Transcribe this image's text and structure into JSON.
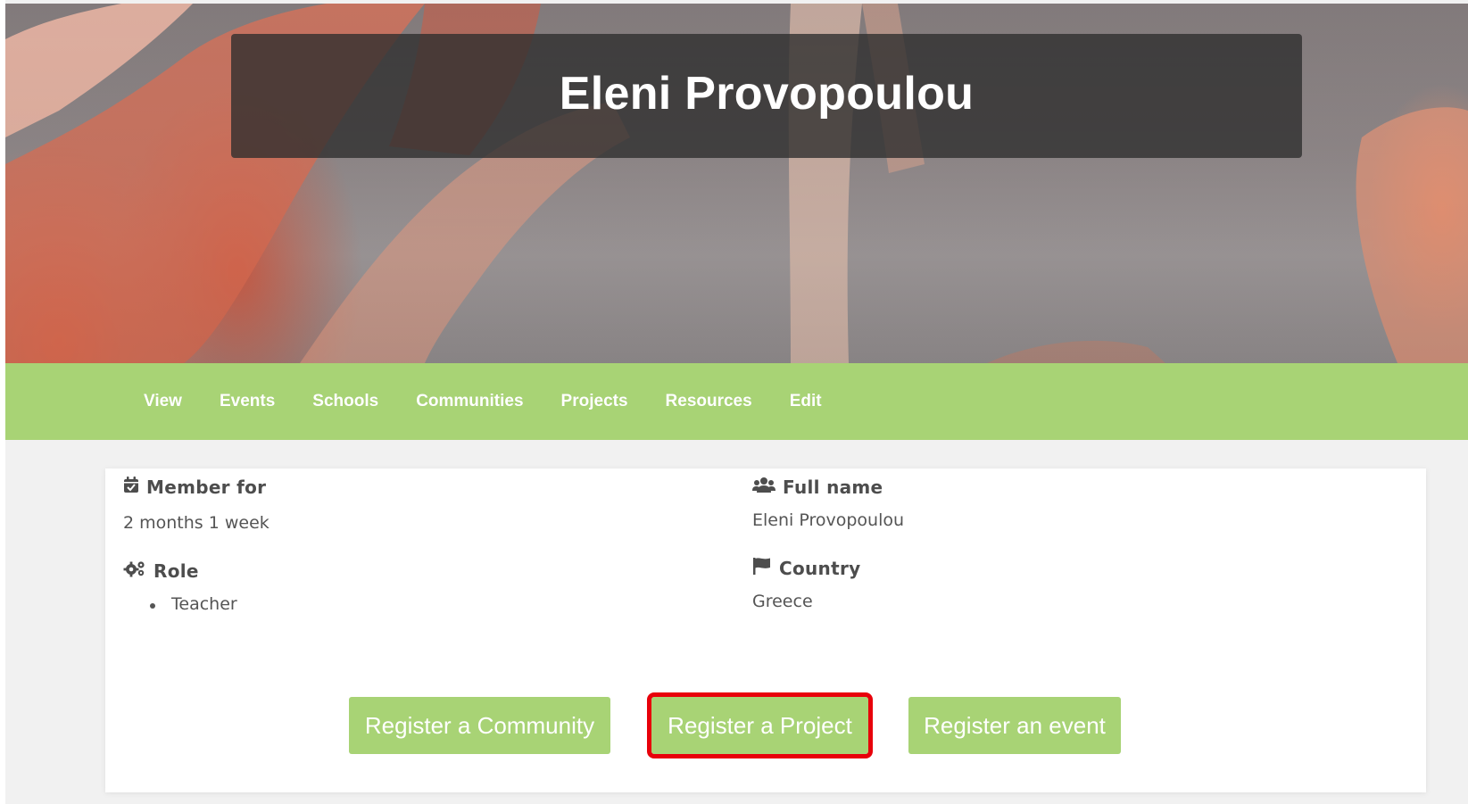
{
  "profile": {
    "name": "Eleni Provopoulou"
  },
  "nav": {
    "items": [
      "View",
      "Events",
      "Schools",
      "Communities",
      "Projects",
      "Resources",
      "Edit"
    ]
  },
  "details": {
    "member_for": {
      "label": "Member for",
      "value": "2 months 1 week",
      "icon": "calendar-check-icon"
    },
    "full_name": {
      "label": "Full name",
      "value": "Eleni Provopoulou",
      "icon": "users-icon"
    },
    "role": {
      "label": "Role",
      "values": [
        "Teacher"
      ],
      "icon": "cogs-icon"
    },
    "country": {
      "label": "Country",
      "value": "Greece",
      "icon": "flag-icon"
    }
  },
  "actions": {
    "register_community": "Register a Community",
    "register_project": "Register a Project",
    "register_event": "Register an event",
    "highlighted": "register_project"
  },
  "colors": {
    "accent_green": "#a8d375",
    "highlight_red": "#e8000a",
    "title_box": "#2d2d2d"
  }
}
